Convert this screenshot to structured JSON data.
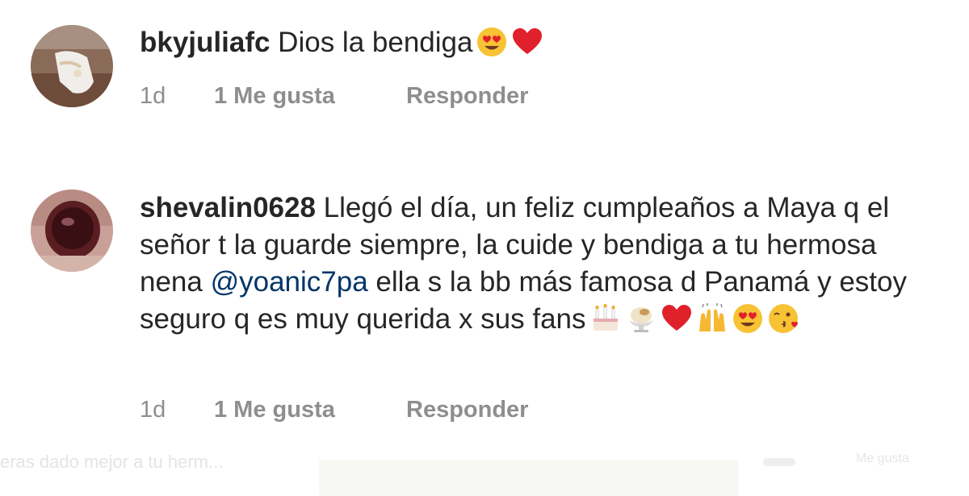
{
  "comments": [
    {
      "username": "bkyjuliafc",
      "text": " Dios la bendiga",
      "mention": "",
      "text_after": "",
      "emojis": [
        "heart-eyes-emoji",
        "red-heart-emoji"
      ],
      "time": "1d",
      "likes": "1 Me gusta",
      "reply": "Responder"
    },
    {
      "username": "shevalin0628",
      "text": " Llegó el día, un feliz cumpleaños a Maya q el señor t la guarde siempre, la cuide y bendiga a tu hermosa nena ",
      "mention": "@yoanic7pa",
      "text_after": " ella s la bb más famosa d Panamá y estoy seguro q es muy querida x sus fans",
      "emojis": [
        "birthday-cake-emoji",
        "ice-cream-emoji",
        "red-heart-emoji",
        "raising-hands-emoji",
        "heart-eyes-emoji",
        "kissing-face-emoji"
      ],
      "time": "1d",
      "likes": "1 Me gusta",
      "reply": "Responder"
    }
  ],
  "faded_preview": {
    "text": "eras dado mejor a tu herm...",
    "label": "Me gusta"
  },
  "colors": {
    "text": "#262626",
    "meta": "#8e8e8e",
    "mention": "#003569",
    "heart": "#e0202b",
    "emoji_face": "#f7c233"
  }
}
